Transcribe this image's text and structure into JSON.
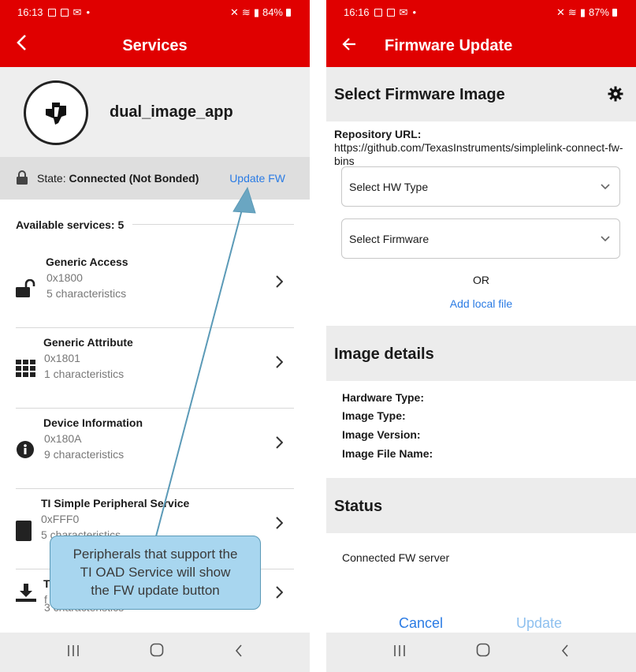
{
  "left": {
    "status": {
      "time": "16:13",
      "battery": "84%"
    },
    "title": "Services",
    "device_name": "dual_image_app",
    "state_label": "State:",
    "state_value": "Connected (Not Bonded)",
    "update_fw": "Update FW",
    "available": "Available services: 5",
    "services": [
      {
        "name": "Generic Access",
        "uuid": "0x1800",
        "chars": "5 characteristics",
        "icon": "lock-open-icon"
      },
      {
        "name": "Generic Attribute",
        "uuid": "0x1801",
        "chars": "1 characteristics",
        "icon": "grid-icon"
      },
      {
        "name": "Device Information",
        "uuid": "0x180A",
        "chars": "9 characteristics",
        "icon": "info-icon"
      },
      {
        "name": "TI Simple Peripheral Service",
        "uuid": "0xFFF0",
        "chars": "5 characteristics",
        "icon": "tablet-icon"
      },
      {
        "name": "T",
        "uuid": "f",
        "chars": "3 characteristics",
        "icon": "download-icon"
      }
    ],
    "callout": [
      "Peripherals that support the",
      "TI OAD Service will show",
      "the FW update button"
    ]
  },
  "right": {
    "status": {
      "time": "16:16",
      "battery": "87%"
    },
    "title": "Firmware Update",
    "select_image": "Select Firmware Image",
    "repo_label": "Repository URL:",
    "repo_url": "https://github.com/TexasInstruments/simplelink-connect-fw-bins",
    "hw_type_placeholder": "Select HW Type",
    "firmware_placeholder": "Select Firmware",
    "or": "OR",
    "add_local": "Add local file",
    "image_details": "Image details",
    "details": [
      "Hardware Type:",
      "Image Type:",
      "Image Version:",
      "Image File Name:"
    ],
    "status_heading": "Status",
    "status_text": "Connected FW server",
    "cancel": "Cancel",
    "update": "Update"
  },
  "colors": {
    "brand": "#e00000",
    "link": "#2a7be4",
    "callout_fill": "#a8d6ef",
    "arrow": "#5b9ab7"
  }
}
